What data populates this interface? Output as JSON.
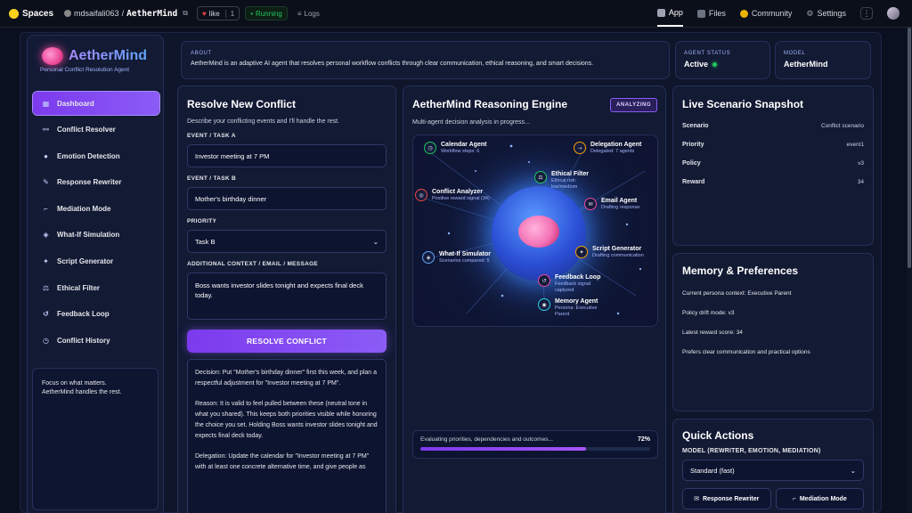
{
  "topbar": {
    "spaces": "Spaces",
    "owner": "mdsaifali063",
    "separator": "/",
    "repo": "AetherMind",
    "like_label": "like",
    "like_count": "1",
    "running_label": "Running",
    "logs_label": "Logs",
    "tabs": [
      {
        "label": "App",
        "icon": "app-icon"
      },
      {
        "label": "Files",
        "icon": "files-icon"
      },
      {
        "label": "Community",
        "icon": "community-icon"
      },
      {
        "label": "Settings",
        "icon": "gear-icon"
      }
    ]
  },
  "sidebar": {
    "title": "AetherMind",
    "subtitle": "Personal Conflict Resolution Agent",
    "items": [
      {
        "label": "Dashboard",
        "icon": "▦"
      },
      {
        "label": "Conflict Resolver",
        "icon": "⚯"
      },
      {
        "label": "Emotion Detection",
        "icon": "●"
      },
      {
        "label": "Response Rewriter",
        "icon": "✎"
      },
      {
        "label": "Mediation Mode",
        "icon": "⌐"
      },
      {
        "label": "What-If Simulation",
        "icon": "◈"
      },
      {
        "label": "Script Generator",
        "icon": "✦"
      },
      {
        "label": "Ethical Filter",
        "icon": "⚖"
      },
      {
        "label": "Feedback Loop",
        "icon": "↺"
      },
      {
        "label": "Conflict History",
        "icon": "◷"
      }
    ],
    "footer_line1": "Focus on what matters.",
    "footer_line2": "AetherMind handles the rest."
  },
  "about": {
    "label": "ABOUT",
    "text": "AetherMind is an adaptive AI agent that resolves personal workflow conflicts through clear communication, ethical reasoning, and smart decisions."
  },
  "agent_status": {
    "label": "AGENT STATUS",
    "value": "Active"
  },
  "model": {
    "label": "MODEL",
    "value": "AetherMind"
  },
  "resolve": {
    "title": "Resolve New Conflict",
    "desc": "Describe your conflicting events and I'll handle the rest.",
    "event_a_label": "EVENT / TASK A",
    "event_a_value": "Investor meeting at 7 PM",
    "event_b_label": "EVENT / TASK B",
    "event_b_value": "Mother's birthday dinner",
    "priority_label": "PRIORITY",
    "priority_value": "Task B",
    "context_label": "ADDITIONAL CONTEXT / EMAIL / MESSAGE",
    "context_value": "Boss wants investor slides tonight and expects final deck today.",
    "button": "RESOLVE CONFLICT",
    "output": [
      "Decision: Put \"Mother's birthday dinner\" first this week, and plan a respectful adjustment for \"Investor meeting at 7 PM\".",
      "Reason: It is valid to feel pulled between these (neutral tone in what you shared). This keeps both priorities visible while honoring the choice you set. Holding Boss wants investor slides tonight and expects final deck today.",
      "Delegation: Update the calendar for \"Investor meeting at 7 PM\" with at least one concrete alternative time, and give people as"
    ]
  },
  "engine": {
    "title": "AetherMind Reasoning Engine",
    "badge": "ANALYZING",
    "desc": "Multi-agent decision analysis in progress...",
    "agents": [
      {
        "name": "Calendar Agent",
        "sub": "Workflow steps: 6",
        "icon": "◷"
      },
      {
        "name": "Delegation Agent",
        "sub": "Delegated: 7 agents",
        "icon": "⇢"
      },
      {
        "name": "Ethical Filter",
        "sub": "Ethical risk: low/medium",
        "icon": "⚖"
      },
      {
        "name": "Conflict Analyzer",
        "sub": "Positive reward signal (34)",
        "icon": "◎"
      },
      {
        "name": "Email Agent",
        "sub": "Drafting response",
        "icon": "✉"
      },
      {
        "name": "What-If Simulator",
        "sub": "Scenarios compared: 5",
        "icon": "◈"
      },
      {
        "name": "Script Generator",
        "sub": "Drafting communication",
        "icon": "✦"
      },
      {
        "name": "Feedback Loop",
        "sub": "Feedback signal captured",
        "icon": "↺"
      },
      {
        "name": "Memory Agent",
        "sub": "Persona: Executive Parent",
        "icon": "◉"
      }
    ],
    "progress_text": "Evaluating priorities, dependencies and outcomes...",
    "progress_pct": "72%",
    "progress_value": 0.72
  },
  "snapshot": {
    "title": "Live Scenario Snapshot",
    "rows": [
      {
        "k": "Scenario",
        "v": "Conflict scenario"
      },
      {
        "k": "Priority",
        "v": "event1"
      },
      {
        "k": "Policy",
        "v": "v3"
      },
      {
        "k": "Reward",
        "v": "34"
      }
    ]
  },
  "memory": {
    "title": "Memory & Preferences",
    "lines": [
      "Current persona context: Executive Parent",
      "Policy drift mode: v3",
      "Latest reward score: 34",
      "Prefers clear communication and practical options"
    ]
  },
  "quick": {
    "title": "Quick Actions",
    "model_label": "MODEL (REWRITER, EMOTION, MEDIATION)",
    "model_value": "Standard (fast)",
    "btn1": "Response Rewriter",
    "btn2": "Mediation Mode"
  }
}
